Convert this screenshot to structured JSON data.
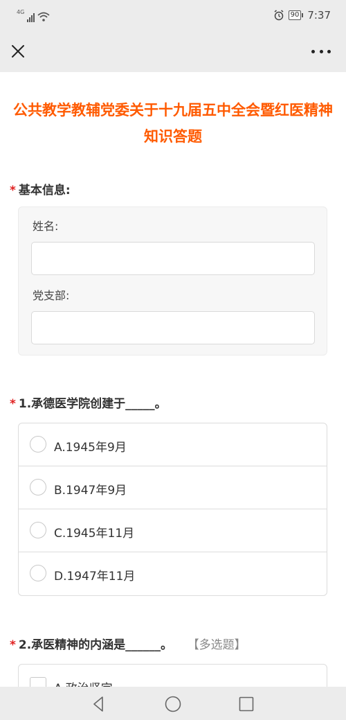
{
  "status_bar": {
    "network": "4G",
    "battery": "90",
    "time": "7:37",
    "icons": [
      "signal-icon",
      "wifi-icon",
      "alarm-icon",
      "battery-icon"
    ]
  },
  "nav": {
    "close_icon": "close-icon",
    "more_icon": "more-icon"
  },
  "survey": {
    "title": "公共教学教辅党委关于十九届五中全会暨红医精神知识答题",
    "required_mark": "*",
    "basic_info": {
      "label": "基本信息:",
      "name_label": "姓名:",
      "name_value": "",
      "branch_label": "党支部:",
      "branch_value": ""
    },
    "questions": [
      {
        "label": "1.承德医学院创建于_____。",
        "type": "single",
        "options": [
          "A.1945年9月",
          "B.1947年9月",
          "C.1945年11月",
          "D.1947年11月"
        ]
      },
      {
        "label": "2.承医精神的内涵是______。",
        "type": "multiple",
        "tag": "【多选题】",
        "options": [
          "A.政治坚定"
        ]
      }
    ]
  },
  "colors": {
    "title": "#ff5a00",
    "required": "#e02020",
    "bar_background": "#ececec"
  },
  "system_nav": {
    "icons": [
      "back-icon",
      "home-icon",
      "recent-apps-icon"
    ]
  }
}
